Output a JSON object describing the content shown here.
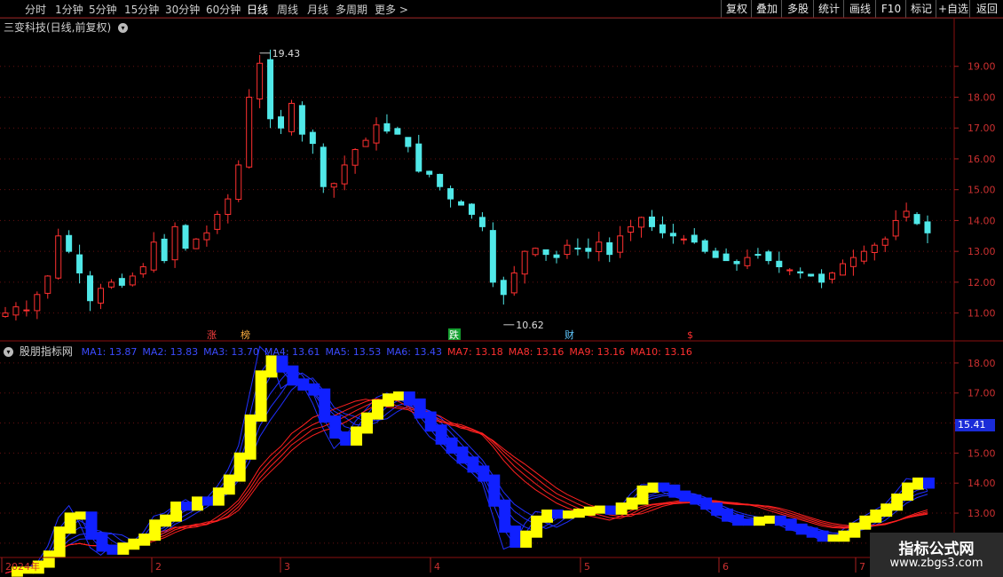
{
  "toolbar": {
    "left": [
      "分时",
      "1分钟",
      "5分钟",
      "15分钟",
      "30分钟",
      "60分钟",
      "日线",
      "周线",
      "月线",
      "多周期",
      "更多 >"
    ],
    "right": [
      "复权",
      "叠加",
      "多股",
      "统计",
      "画线",
      "F10",
      "标记",
      "+自选",
      "返回"
    ]
  },
  "main_title": "三变科技(日线,前复权)",
  "indicator": {
    "name": "股朋指标网",
    "ma": [
      {
        "label": "MA1: 13.87",
        "color": "blue"
      },
      {
        "label": "MA2: 13.83",
        "color": "blue"
      },
      {
        "label": "MA3: 13.70",
        "color": "blue"
      },
      {
        "label": "MA4: 13.61",
        "color": "blue"
      },
      {
        "label": "MA5: 13.53",
        "color": "blue"
      },
      {
        "label": "MA6: 13.43",
        "color": "blue"
      },
      {
        "label": "MA7: 13.18",
        "color": "red"
      },
      {
        "label": "MA8: 13.16",
        "color": "red"
      },
      {
        "label": "MA9: 13.16",
        "color": "red"
      },
      {
        "label": "MA10: 13.16",
        "color": "red"
      }
    ],
    "current_price": "15.41"
  },
  "chart_data": [
    {
      "type": "candlestick",
      "title": "三变科技(日线,前复权)",
      "y_ticks": [
        "19.00",
        "18.00",
        "17.00",
        "16.00",
        "15.00",
        "14.00",
        "13.00",
        "12.00",
        "11.00"
      ],
      "ylim": [
        10.5,
        20.0
      ],
      "annotations": {
        "high": "19.43",
        "low": "10.62"
      },
      "markers": [
        "涨",
        "榜",
        "跌",
        "财",
        "$"
      ],
      "closes": [
        11.0,
        11.2,
        11.1,
        11.6,
        12.2,
        13.5,
        13.0,
        12.3,
        11.4,
        11.8,
        12.0,
        11.9,
        12.2,
        12.5,
        13.3,
        12.7,
        13.8,
        13.1,
        13.4,
        13.6,
        14.2,
        14.7,
        15.8,
        18.0,
        19.1,
        17.3,
        17.0,
        17.8,
        16.8,
        16.5,
        15.1,
        15.2,
        15.8,
        16.3,
        16.6,
        17.1,
        16.9,
        16.8,
        16.4,
        15.6,
        15.5,
        15.1,
        14.7,
        14.5,
        14.2,
        13.8,
        12.0,
        11.6,
        12.3,
        13.0,
        13.1,
        12.9,
        12.8,
        13.2,
        13.1,
        13.0,
        13.3,
        12.9,
        13.5,
        13.8,
        14.1,
        13.8,
        13.6,
        13.5,
        13.4,
        13.3,
        13.0,
        12.8,
        12.7,
        12.6,
        12.8,
        12.9,
        12.7,
        12.5,
        12.4,
        12.3,
        12.2,
        12.0,
        12.3,
        12.6,
        12.8,
        13.0,
        13.2,
        13.4,
        14.0,
        14.3,
        13.9,
        13.6
      ]
    },
    {
      "type": "line",
      "title": "股朋指标网",
      "y_ticks": [
        "18.00",
        "17.00",
        "16.00",
        "15.00",
        "14.00",
        "13.00",
        "12.00"
      ],
      "ylim": [
        11.7,
        18.5
      ],
      "series": [
        {
          "name": "MA1",
          "color": "#2030ff"
        },
        {
          "name": "MA2",
          "color": "#2030ff"
        },
        {
          "name": "MA3",
          "color": "#2030ff"
        },
        {
          "name": "MA4",
          "color": "#2030ff"
        },
        {
          "name": "MA5",
          "color": "#2030ff"
        },
        {
          "name": "MA6",
          "color": "#2030ff"
        },
        {
          "name": "MA7",
          "color": "#ff2020"
        },
        {
          "name": "MA8",
          "color": "#ff2020"
        },
        {
          "name": "MA9",
          "color": "#ff2020"
        },
        {
          "name": "MA10",
          "color": "#ff2020"
        }
      ]
    }
  ],
  "x_axis": [
    "2024年",
    "2",
    "3",
    "4",
    "5",
    "6",
    "7"
  ],
  "watermark": {
    "title": "指标公式网",
    "url": "www.zbgs3.com"
  }
}
